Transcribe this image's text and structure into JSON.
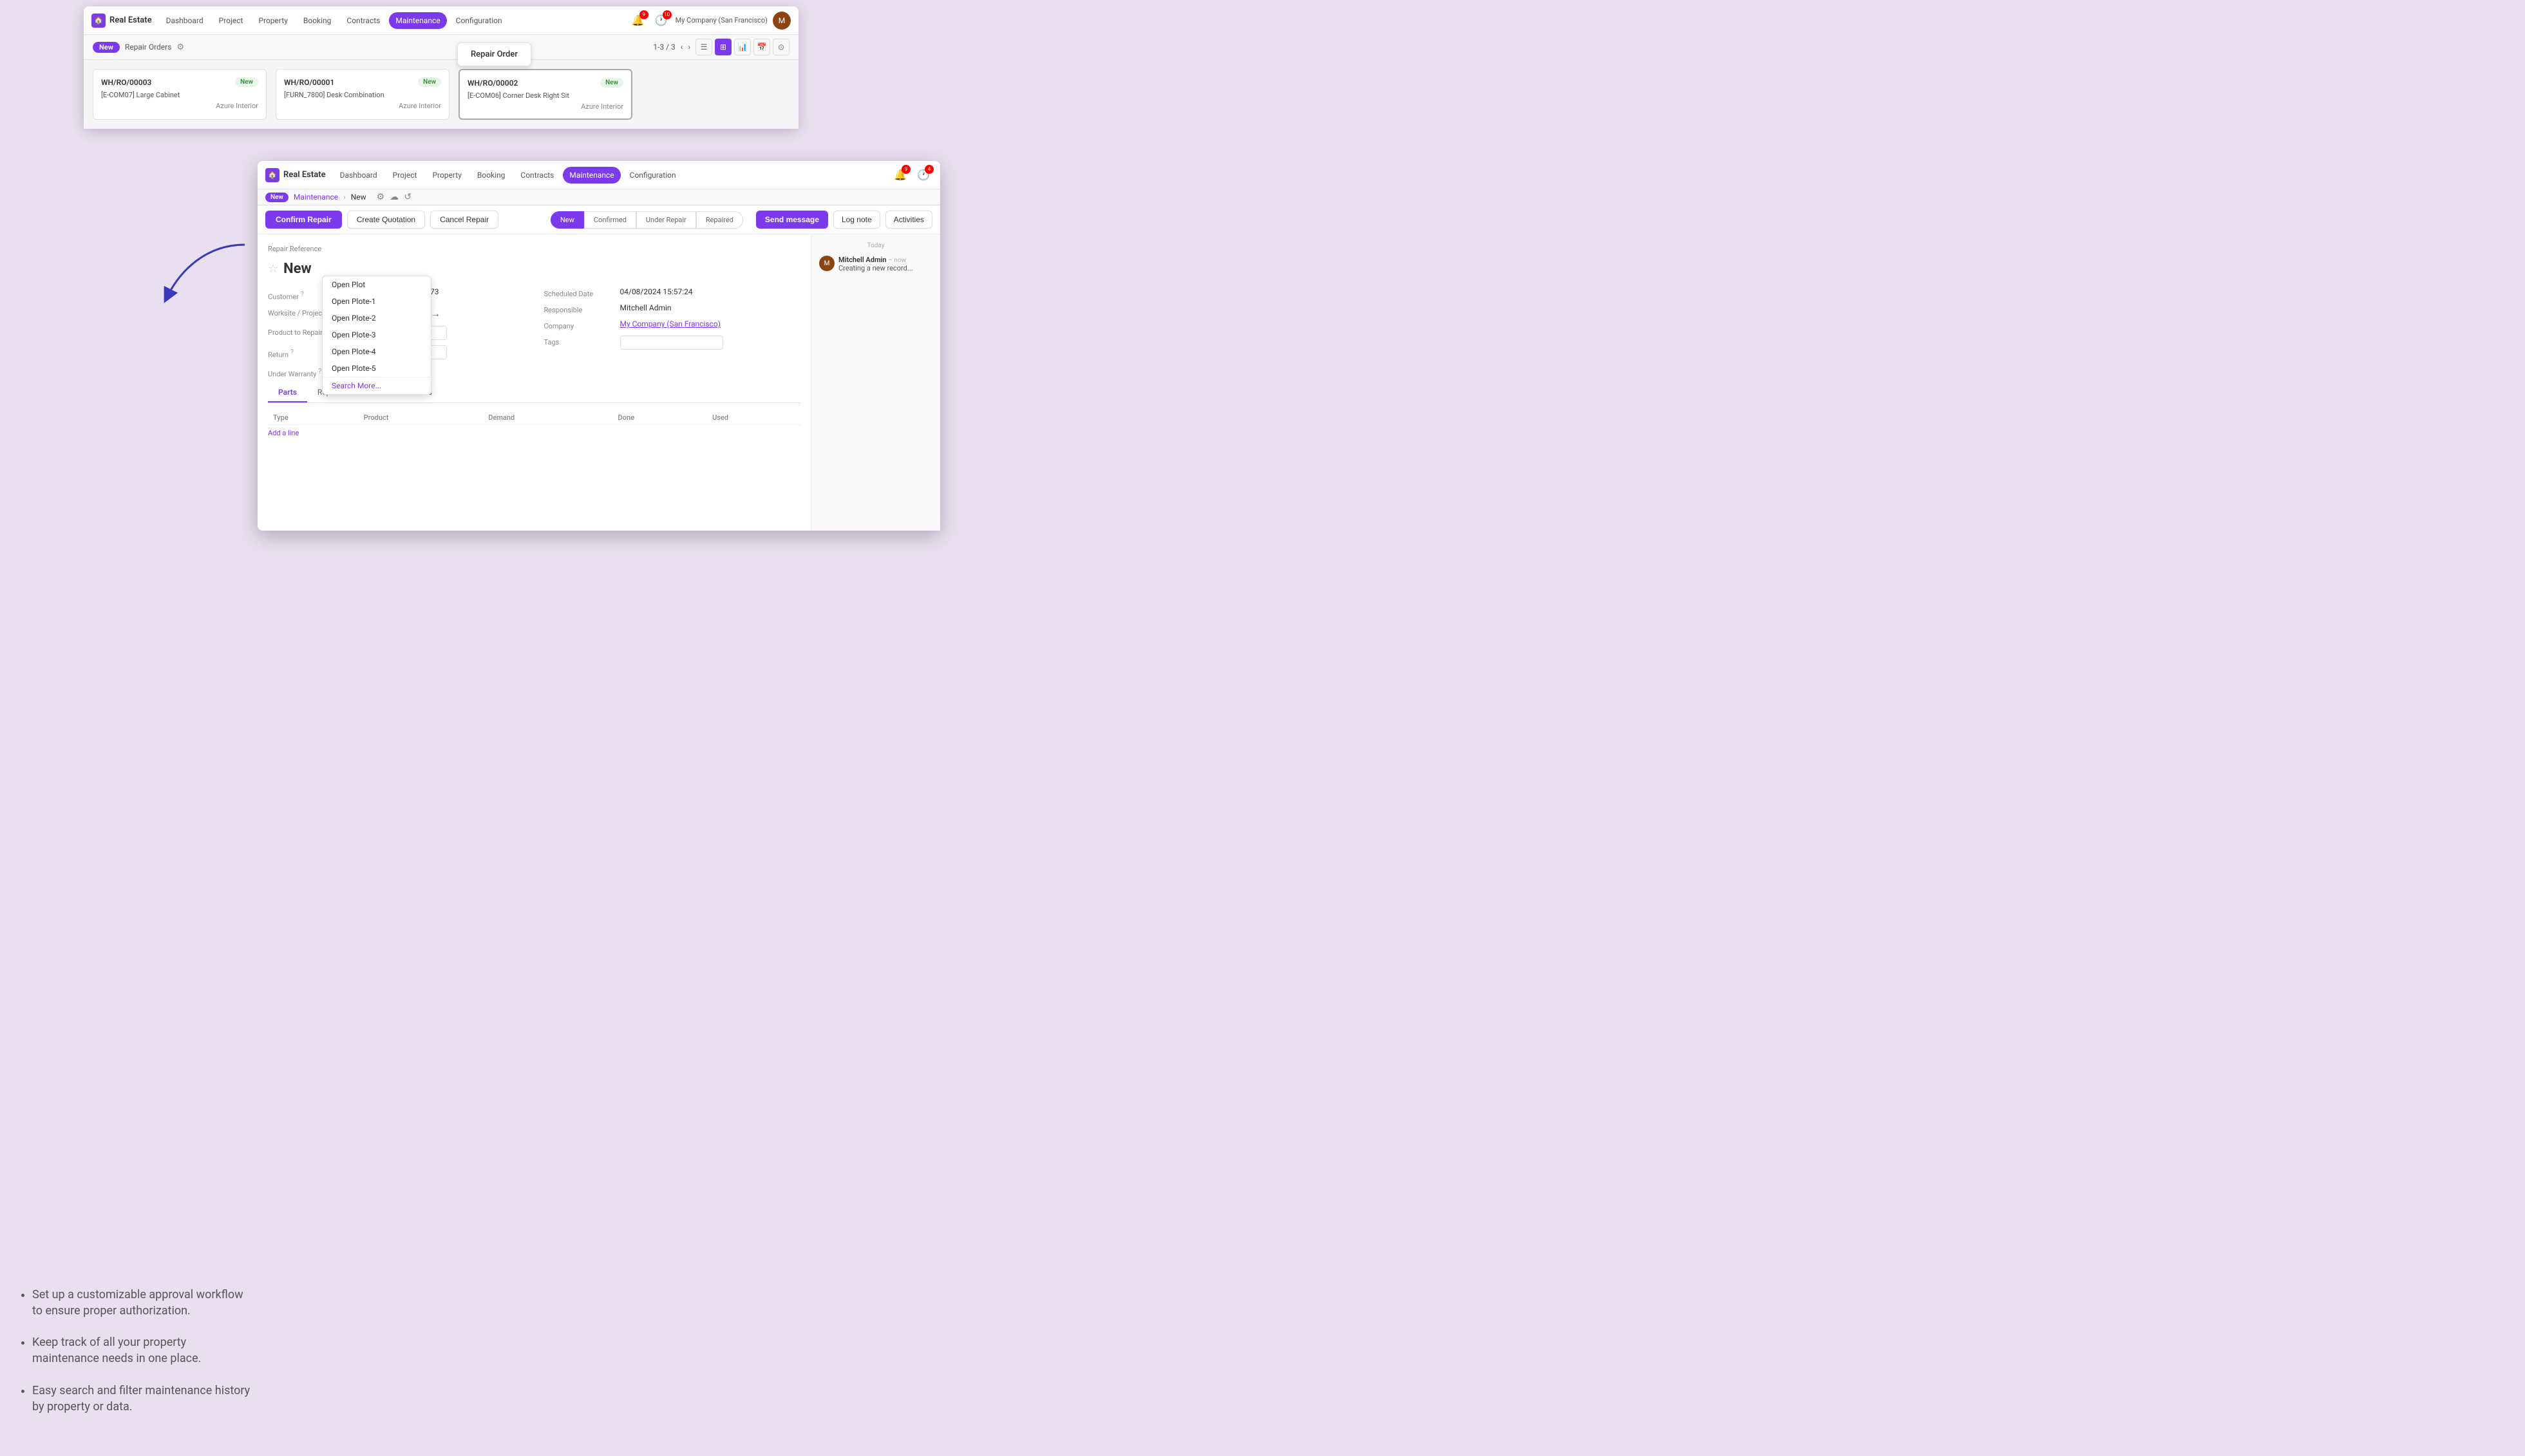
{
  "background": {
    "bullets": [
      "Set up a customizable approval workflow to ensure proper authorization.",
      "Keep track of all your property maintenance needs in one place.",
      "Easy search and filter maintenance history by property or data."
    ]
  },
  "window1": {
    "navbar": {
      "brand": "Real Estate",
      "items": [
        "Dashboard",
        "Project",
        "Property",
        "Booking",
        "Contracts",
        "Maintenance",
        "Configuration"
      ],
      "active_item": "Maintenance",
      "company": "My Company (San Francisco)",
      "notifications": [
        {
          "count": 9
        },
        {
          "count": 10
        }
      ]
    },
    "subheader": {
      "badge": "New",
      "breadcrumb": "Repair Orders",
      "pagination": "1-3 / 3"
    },
    "cards": [
      {
        "ref": "WH/RO/00003",
        "badge": "New",
        "product": "[E-COM07] Large Cabinet",
        "company": "Azure Interior"
      },
      {
        "ref": "WH/RO/00001",
        "badge": "New",
        "product": "[FURN_7800] Desk Combination",
        "company": "Azure Interior"
      },
      {
        "ref": "WH/RO/00002",
        "badge": "New",
        "product": "[E-COM06] Corner Desk Right Sit",
        "company": "Azure Interior"
      }
    ],
    "tooltip": "Repair Order"
  },
  "window2": {
    "navbar": {
      "brand": "Real Estate",
      "items": [
        "Dashboard",
        "Project",
        "Property",
        "Booking",
        "Contracts",
        "Maintenance",
        "Configuration"
      ],
      "active_item": "Maintenance",
      "notifications": [
        {
          "count": 9
        },
        {
          "count": 4
        }
      ]
    },
    "subheader": {
      "badge": "New",
      "breadcrumb_link": "Maintenance",
      "breadcrumb_current": "New"
    },
    "action_buttons": {
      "confirm": "Confirm Repair",
      "quotation": "Create Quotation",
      "cancel": "Cancel Repair"
    },
    "status_steps": [
      "New",
      "Confirmed",
      "Under Repair",
      "Repaired"
    ],
    "active_step": "New",
    "chatter_buttons": {
      "send_message": "Send message",
      "log_note": "Log note",
      "activities": "Activities"
    },
    "form": {
      "title": "New",
      "ref_label": "Repair Reference",
      "fields_left": [
        {
          "label": "Customer",
          "help": true,
          "value": "Deco Addict – US12345673"
        },
        {
          "label": "Worksite / Project",
          "help": false,
          "value": "Open Plot",
          "type": "dropdown"
        },
        {
          "label": "Product to Repair",
          "help": false,
          "value": ""
        },
        {
          "label": "Return",
          "help": true,
          "value": ""
        },
        {
          "label": "Under Warranty",
          "help": true,
          "value": ""
        }
      ],
      "fields_right": [
        {
          "label": "Scheduled Date",
          "value": "04/08/2024 15:57:24"
        },
        {
          "label": "Responsible",
          "value": "Mitchell Admin"
        },
        {
          "label": "Company",
          "value": "My Company (San Francisco)",
          "type": "link"
        },
        {
          "label": "Tags",
          "value": ""
        }
      ],
      "tabs": [
        "Parts",
        "Repair Notes",
        "Miscellaneous"
      ],
      "active_tab": "Parts",
      "table_columns": [
        "Type",
        "Product",
        "Demand",
        "Done",
        "Used"
      ],
      "add_line": "Add a line"
    },
    "dropdown": {
      "items": [
        "Open Plot",
        "Open Plote-1",
        "Open Plote-2",
        "Open Plote-3",
        "Open Plote-4",
        "Open Plote-5",
        "Search More..."
      ]
    },
    "chatter": {
      "today_label": "Today",
      "messages": [
        {
          "author": "Mitchell Admin",
          "time": "now",
          "body": "Creating a new record..."
        }
      ]
    }
  }
}
